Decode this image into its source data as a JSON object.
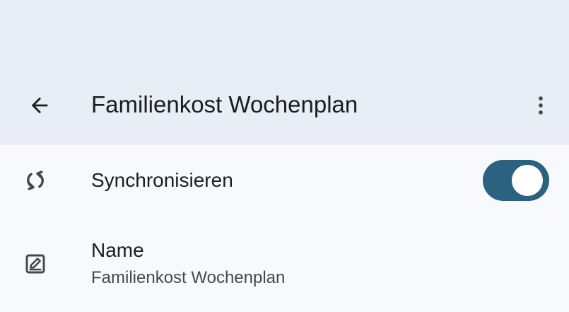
{
  "toolbar": {
    "back_icon": "arrow-back-icon",
    "title": "Familienkost Wochenplan",
    "more_icon": "more-vert-icon"
  },
  "settings": {
    "sync": {
      "icon": "sync-icon",
      "label": "Synchronisieren",
      "enabled": true
    },
    "name": {
      "icon": "edit-square-icon",
      "label": "Name",
      "value": "Familienkost Wochenplan"
    }
  },
  "colors": {
    "appbar_bg": "#e9edf5",
    "page_bg": "#f8f9fd",
    "switch_on": "#2b6280",
    "primary_text": "#1c1d21",
    "secondary_text": "#45474d",
    "icon": "#45474d"
  }
}
